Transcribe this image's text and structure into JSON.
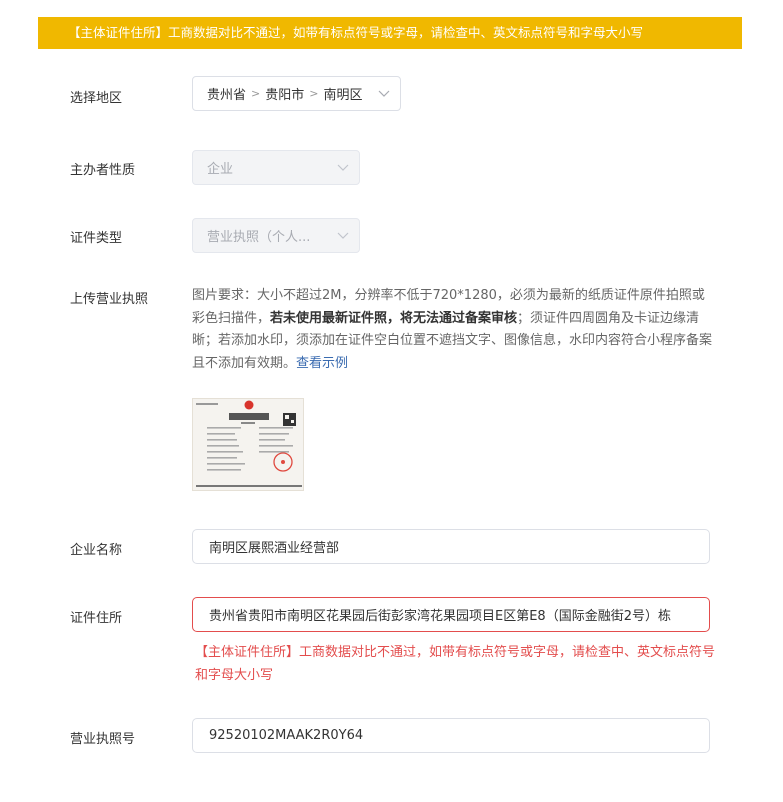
{
  "banner": {
    "text": "【主体证件住所】工商数据对比不通过，如带有标点符号或字母，请检查中、英文标点符号和字母大小写"
  },
  "region": {
    "label": "选择地区",
    "province": "贵州省",
    "city": "贵阳市",
    "district": "南明区",
    "separator": ">"
  },
  "organizer_type": {
    "label": "主办者性质",
    "value": "企业"
  },
  "cert_type": {
    "label": "证件类型",
    "value": "营业执照（个人..."
  },
  "upload": {
    "label": "上传营业执照",
    "desc_part1": "图片要求：大小不超过2M，分辨率不低于720*1280，必须为最新的纸质证件原件拍照或彩色扫描件，",
    "desc_bold": "若未使用最新证件照，将无法通过备案审核",
    "desc_part2": "；须证件四周圆角及卡证边缘清晰；若添加水印，须添加在证件空白位置不遮挡文字、图像信息，水印内容符合小程序备案且不添加有效期。",
    "example_link": "查看示例"
  },
  "company_name": {
    "label": "企业名称",
    "value": "南明区展熙酒业经营部"
  },
  "cert_address": {
    "label": "证件住所",
    "value": "贵州省贵阳市南明区花果园后街彭家湾花果园项目E区第E8（国际金融街2号）栋",
    "error": "【主体证件住所】工商数据对比不通过，如带有标点符号或字母，请检查中、英文标点符号和字母大小写"
  },
  "license_no": {
    "label": "营业执照号",
    "value": "92520102MAAK2R0Y64"
  },
  "colors": {
    "banner": "#f0b800",
    "error": "#e34d4d",
    "link": "#3a6bb0"
  }
}
